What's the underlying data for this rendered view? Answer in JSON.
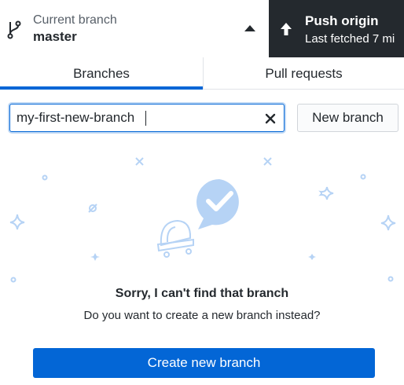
{
  "toolbar": {
    "branch": {
      "caption": "Current branch",
      "name": "master",
      "icon": "git-branch-icon"
    },
    "push": {
      "title": "Push origin",
      "subtitle": "Last fetched 7 mi",
      "icon": "arrow-up-icon"
    }
  },
  "tabs": [
    {
      "label": "Branches",
      "selected": true
    },
    {
      "label": "Pull requests",
      "selected": false
    }
  ],
  "filter": {
    "value": "my-first-new-branch",
    "clear_icon": "x-icon"
  },
  "new_branch_label": "New branch",
  "empty_state": {
    "title": "Sorry, I can't find that branch",
    "subtitle": "Do you want to create a new branch instead?",
    "button_label": "Create new branch"
  },
  "colors": {
    "accent": "#0366d6",
    "dark": "#24292e",
    "illustration": "#b6d3f5"
  }
}
